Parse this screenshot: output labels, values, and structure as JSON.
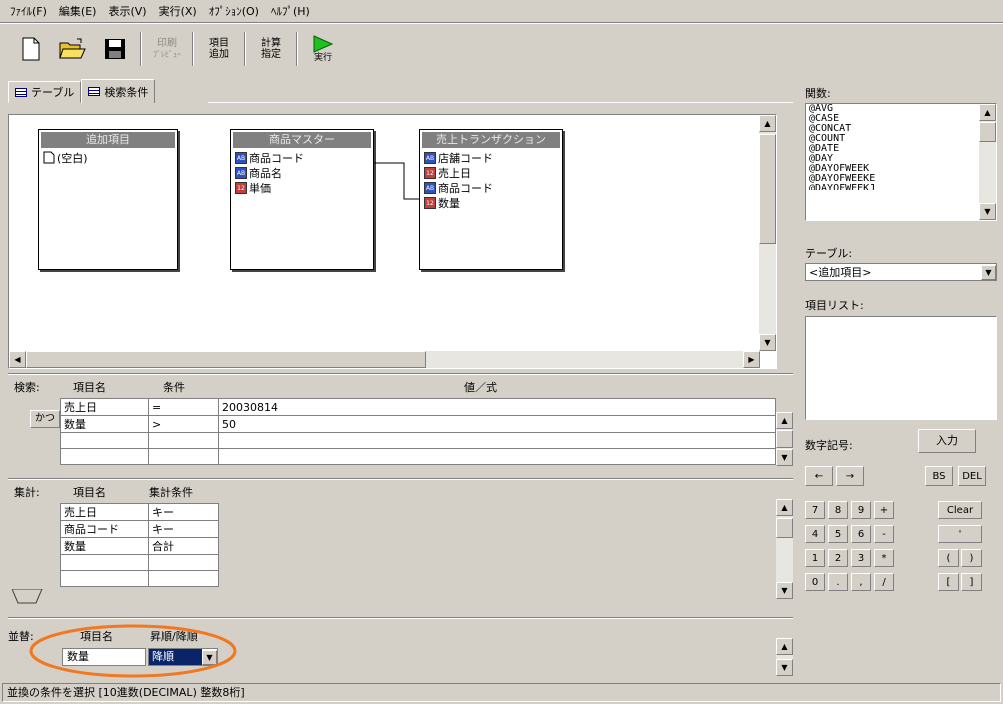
{
  "menu": [
    "ﾌｧｲﾙ(F)",
    "編集(E)",
    "表示(V)",
    "実行(X)",
    "ｵﾌﾟｼｮﾝ(O)",
    "ﾍﾙﾌﾟ(H)"
  ],
  "toolbar": {
    "new_icon": "new-document-icon",
    "open_icon": "open-folder-icon",
    "save_icon": "save-disk-icon",
    "disabled_label_1": "印刷",
    "disabled_label_2": "ﾌﾟﾚﾋﾞｭｰ",
    "add_item_1": "項目",
    "add_item_2": "追加",
    "calc_1": "計算",
    "calc_2": "指定",
    "run": "実行"
  },
  "tabs": [
    "テーブル",
    "検索条件"
  ],
  "tables": [
    {
      "title": "追加項目",
      "fields": [
        {
          "type": "blank",
          "name": "(空白)"
        }
      ]
    },
    {
      "title": "商品マスター",
      "fields": [
        {
          "type": "ab",
          "name": "商品コード"
        },
        {
          "type": "ab",
          "name": "商品名"
        },
        {
          "type": "num",
          "name": "単価"
        }
      ]
    },
    {
      "title": "売上トランザクション",
      "fields": [
        {
          "type": "ab",
          "name": "店舗コード"
        },
        {
          "type": "num",
          "name": "売上日"
        },
        {
          "type": "ab",
          "name": "商品コード"
        },
        {
          "type": "num",
          "name": "数量"
        }
      ]
    }
  ],
  "search": {
    "label": "検索:",
    "col_name": "項目名",
    "col_cond": "条件",
    "col_value": "値／式",
    "and_label": "かつ",
    "rows": [
      {
        "name": "売上日",
        "cond": "=",
        "value": "20030814"
      },
      {
        "name": "数量",
        "cond": ">",
        "value": "50"
      },
      {
        "name": "",
        "cond": "",
        "value": ""
      },
      {
        "name": "",
        "cond": "",
        "value": ""
      }
    ]
  },
  "aggregate": {
    "label": "集計:",
    "col_name": "項目名",
    "col_cond": "集計条件",
    "rows": [
      {
        "name": "売上日",
        "cond": "キー"
      },
      {
        "name": "商品コード",
        "cond": "キー"
      },
      {
        "name": "数量",
        "cond": "合計"
      },
      {
        "name": "",
        "cond": ""
      },
      {
        "name": "",
        "cond": ""
      }
    ]
  },
  "sort": {
    "label": "並替:",
    "col_name": "項目名",
    "col_order": "昇順/降順",
    "rows": [
      {
        "name": "数量",
        "order": "降順"
      }
    ]
  },
  "status": "並換の条件を選択 [10進数(DECIMAL) 整数8桁]",
  "right": {
    "functions_label": "関数:",
    "functions": [
      "@AVG",
      "@CASE",
      "@CONCAT",
      "@COUNT",
      "@DATE",
      "@DAY",
      "@DAYOFWEEK",
      "@DAYOFWEEKE",
      "@DAYOFWEEKJ"
    ],
    "table_label": "テーブル:",
    "table_value": "<追加項目>",
    "item_list_label": "項目リスト:",
    "numsym_label": "数字記号:",
    "input_button": "入力",
    "left_arrow": "←",
    "right_arrow": "→",
    "bs": "BS",
    "del": "DEL",
    "keys": [
      "7",
      "8",
      "9",
      "+",
      "4",
      "5",
      "6",
      "-",
      "1",
      "2",
      "3",
      "*",
      "0",
      ".",
      ",",
      "/"
    ],
    "clear": "Clear",
    "quote": "'",
    "paren_open": "(",
    "paren_close": ")",
    "bracket_open": "[",
    "bracket_close": "]"
  },
  "colors": {
    "highlight": "#0a246a",
    "circle": "#f07820",
    "face": "#d4d0c8"
  }
}
